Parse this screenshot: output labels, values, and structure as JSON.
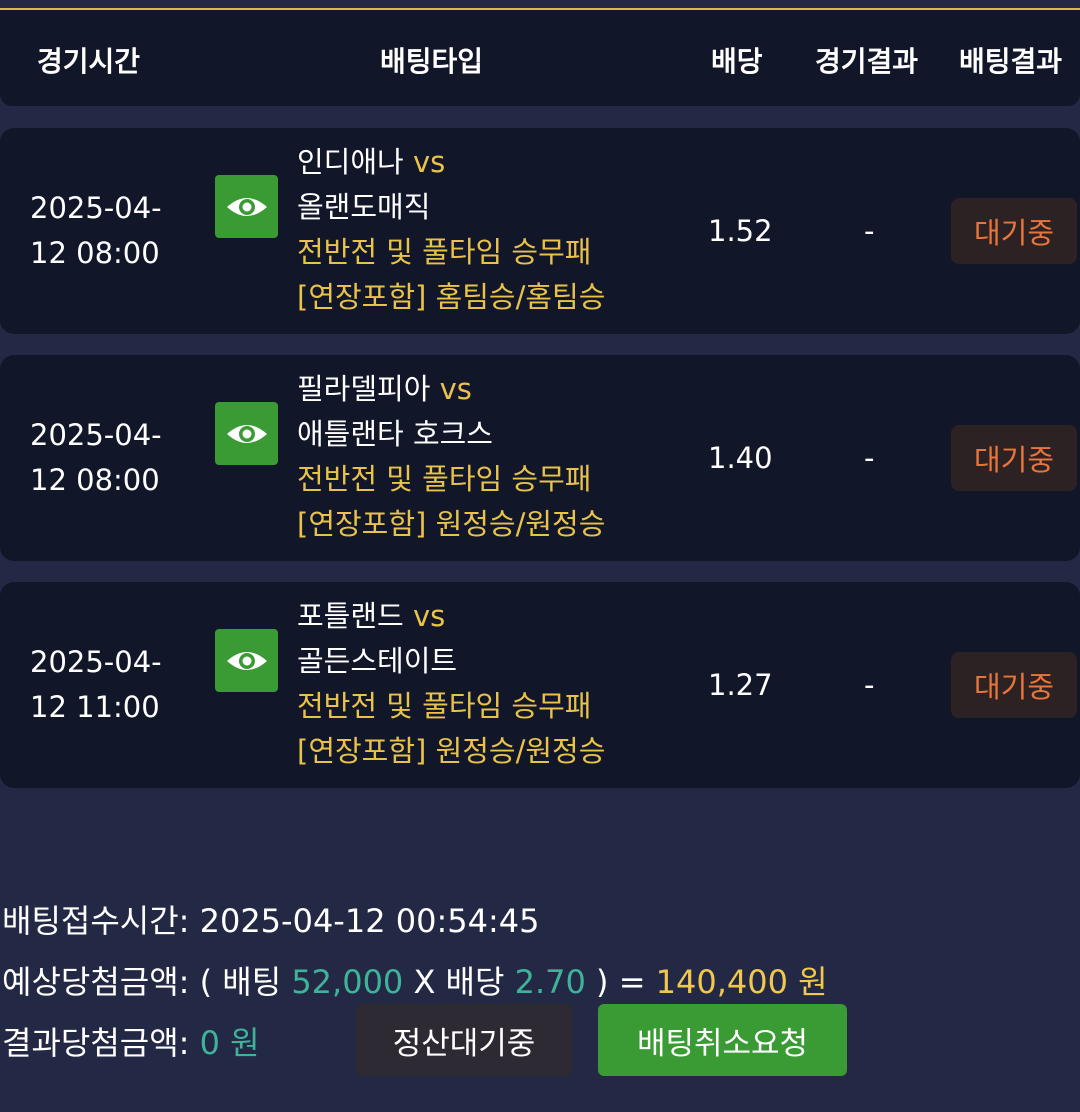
{
  "header": {
    "time": "경기시간",
    "type": "배팅타입",
    "odds": "배당",
    "game_result": "경기결과",
    "bet_result": "배팅결과"
  },
  "bets": [
    {
      "date": "2025-04-",
      "time": "12 08:00",
      "home": "인디애나",
      "vs": "vs",
      "away": "올랜도매직",
      "market": "전반전 및 풀타임 승무패",
      "pick": "[연장포함] 홈팀승/홈팀승",
      "odds": "1.52",
      "result": "-",
      "status": "대기중"
    },
    {
      "date": "2025-04-",
      "time": "12 08:00",
      "home": "필라델피아",
      "vs": "vs",
      "away": "애틀랜타 호크스",
      "market": "전반전 및 풀타임 승무패",
      "pick": "[연장포함] 원정승/원정승",
      "odds": "1.40",
      "result": "-",
      "status": "대기중"
    },
    {
      "date": "2025-04-",
      "time": "12 11:00",
      "home": "포틀랜드",
      "vs": "vs",
      "away": "골든스테이트",
      "market": "전반전 및 풀타임 승무패",
      "pick": "[연장포함] 원정승/원정승",
      "odds": "1.27",
      "result": "-",
      "status": "대기중"
    }
  ],
  "summary": {
    "received_label": "배팅접수시간:",
    "received_value": "2025-04-12 00:54:45",
    "expected_label": "예상당첨금액:",
    "expected_open": "( 배팅",
    "stake": "52,000",
    "times": "X 배당",
    "total_odds": "2.70",
    "expected_close": ") =",
    "payout": "140,400 원",
    "result_label": "결과당첨금액:",
    "result_value": "0 원"
  },
  "buttons": {
    "settle": "정산대기중",
    "cancel": "배팅취소요청"
  },
  "colors": {
    "background": "#232944",
    "card": "#111628",
    "accent_yellow": "#e9c24a",
    "status_orange": "#e8753a",
    "green": "#3a9a34",
    "teal": "#3fb39a"
  },
  "icons": {
    "view": "eye-icon"
  }
}
